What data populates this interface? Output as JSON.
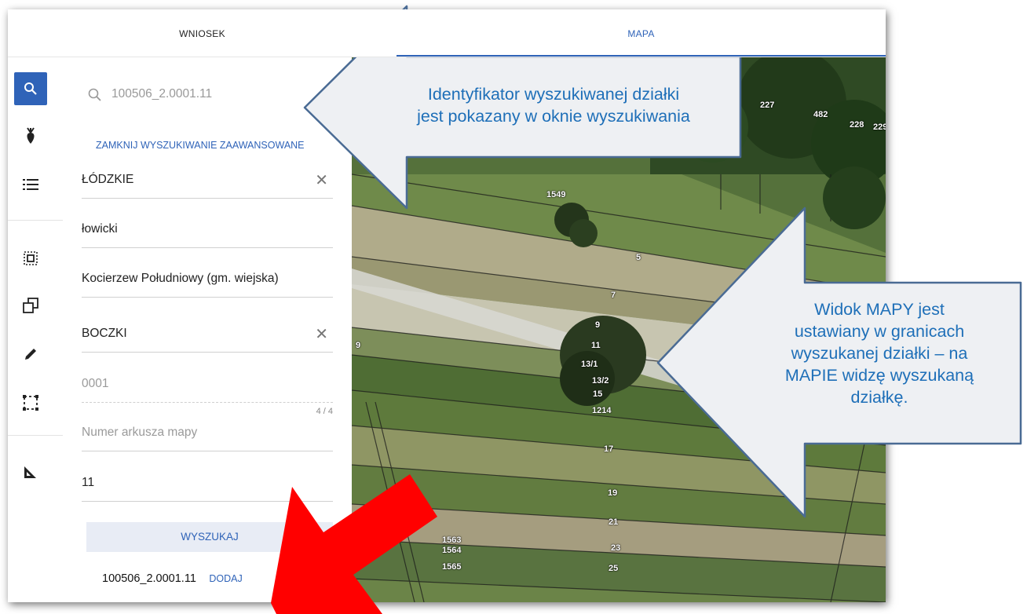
{
  "tabs": {
    "wniosek": "WNIOSEK",
    "mapa": "MAPA"
  },
  "search": {
    "query": "100506_2.0001.11",
    "advanced_toggle": "ZAMKNIJ WYSZUKIWANIE ZAAWANSOWANE",
    "voivodeship": "ŁÓDZKIE",
    "county": "łowicki",
    "commune": "Kocierzew Południowy (gm. wiejska)",
    "precinct": "BOCZKI",
    "precinct_number_placeholder": "0001",
    "char_counter": "4 / 4",
    "sheet_placeholder": "Numer arkusza mapy",
    "parcel_number": "11",
    "search_button": "WYSZUKAJ",
    "result_id": "100506_2.0001.11",
    "add_link": "DODAJ"
  },
  "map_labels": [
    "227",
    "482",
    "228",
    "229",
    "1549",
    "5",
    "7",
    "9",
    "11",
    "13/1",
    "13/2",
    "15",
    "1214",
    "17",
    "19",
    "21",
    "23",
    "25",
    "1563",
    "1564",
    "1565",
    "9"
  ],
  "callouts": {
    "top": [
      "Identyfikator wyszukiwanej działki",
      "jest pokazany w oknie wyszukiwania"
    ],
    "right": [
      "Widok MAPY jest",
      "ustawiany w granicach",
      "wyszukanej działki – na",
      "MAPIE widzę wyszukaną",
      "działkę."
    ]
  },
  "colors": {
    "accent": "#2f63b8",
    "callout_fill": "#eef0f3",
    "callout_border": "#4a6b94",
    "callout_text": "#1e6fb8",
    "red_arrow": "#ff0000"
  },
  "icons": [
    "search-icon",
    "crop-icon",
    "list-icon",
    "select-area-icon",
    "copy-icon",
    "pencil-icon",
    "dashed-rectangle-icon",
    "ruler-icon",
    "magnifier-icon",
    "close-icon"
  ]
}
